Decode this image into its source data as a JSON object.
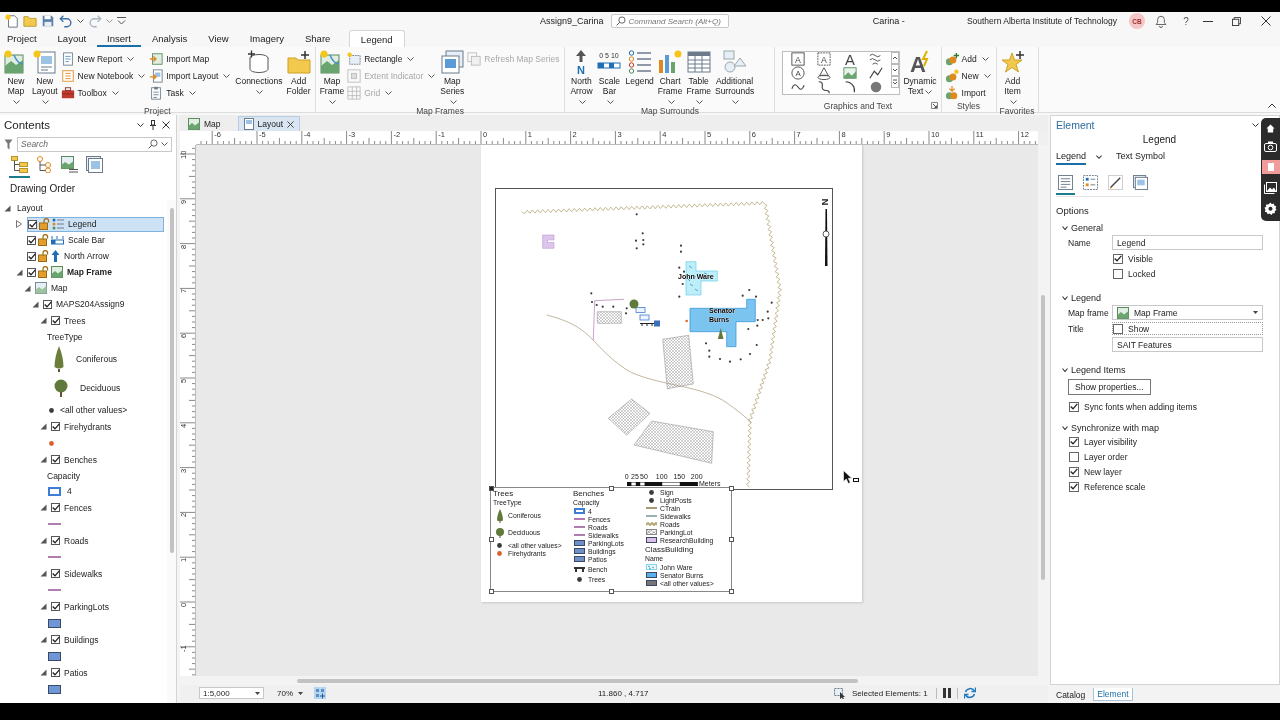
{
  "title_bar": {
    "project": "Assign9_Carina",
    "search": {
      "placeholder": "Command Search (Alt+Q)"
    },
    "user": "Carina -",
    "organization": "Southern Alberta Institute of Technology",
    "avatar": "CB",
    "help": "?"
  },
  "ribbon": {
    "tabs": [
      {
        "label": "Project",
        "selected": false,
        "contextual": false
      },
      {
        "label": "Layout",
        "selected": false,
        "contextual": false
      },
      {
        "label": "Insert",
        "selected": true,
        "contextual": false
      },
      {
        "label": "Analysis",
        "selected": false,
        "contextual": false
      },
      {
        "label": "View",
        "selected": false,
        "contextual": false
      },
      {
        "label": "Imagery",
        "selected": false,
        "contextual": false
      },
      {
        "label": "Share",
        "selected": false,
        "contextual": false
      },
      {
        "label": "Legend",
        "selected": false,
        "contextual": true
      }
    ],
    "groups": [
      {
        "label": "Project",
        "launcher": false,
        "items": [
          {
            "kind": "large",
            "label": "New Map",
            "dropdown": true,
            "disabled": false
          },
          {
            "kind": "large",
            "label": "New Layout",
            "dropdown": true,
            "disabled": false
          },
          {
            "kind": "stack",
            "items": [
              {
                "label": "New Report",
                "dropdown": true,
                "disabled": false
              },
              {
                "label": "New Notebook",
                "dropdown": true,
                "disabled": false
              },
              {
                "label": "Toolbox",
                "dropdown": true,
                "disabled": false
              }
            ]
          },
          {
            "kind": "stack",
            "items": [
              {
                "label": "Import Map",
                "dropdown": false,
                "disabled": false
              },
              {
                "label": "Import Layout",
                "dropdown": true,
                "disabled": false
              },
              {
                "label": "Task",
                "dropdown": true,
                "disabled": false
              }
            ]
          },
          {
            "kind": "large",
            "label": "Connections",
            "dropdown": true,
            "disabled": false
          },
          {
            "kind": "large",
            "label": "Add Folder",
            "dropdown": false,
            "disabled": false
          }
        ]
      },
      {
        "label": "Map Frames",
        "launcher": false,
        "items": [
          {
            "kind": "large",
            "label": "Map Frame",
            "dropdown": true,
            "disabled": false
          },
          {
            "kind": "stack",
            "items": [
              {
                "label": "Rectangle",
                "dropdown": true,
                "disabled": false
              },
              {
                "label": "Extent Indicator",
                "dropdown": true,
                "disabled": true
              },
              {
                "label": "Grid",
                "dropdown": true,
                "disabled": true
              }
            ]
          },
          {
            "kind": "large",
            "label": "Map Series",
            "dropdown": true,
            "disabled": false
          },
          {
            "kind": "stack",
            "items": [
              {
                "label": "Refresh Map Series",
                "dropdown": false,
                "disabled": true
              }
            ]
          }
        ]
      },
      {
        "label": "Map Surrounds",
        "launcher": false,
        "items": [
          {
            "kind": "large",
            "label": "North Arrow",
            "icon_text": "N",
            "dropdown": true,
            "disabled": false
          },
          {
            "kind": "large",
            "label": "Scale Bar",
            "icon_text": "0 5 10",
            "dropdown": true,
            "disabled": false
          },
          {
            "kind": "large",
            "label": "Legend",
            "dropdown": false,
            "disabled": false
          },
          {
            "kind": "large",
            "label": "Chart Frame",
            "dropdown": true,
            "disabled": false
          },
          {
            "kind": "large",
            "label": "Table Frame",
            "dropdown": true,
            "disabled": false
          },
          {
            "kind": "large",
            "label": "Additional Surrounds",
            "dropdown": true,
            "disabled": false
          }
        ]
      },
      {
        "label": "Graphics and Text",
        "launcher": true,
        "items": [
          {
            "kind": "gallery",
            "items": [
              {
                "kind": "text",
                "icon_text": "A"
              },
              {
                "kind": "text",
                "icon_text": "A"
              },
              {
                "kind": "text",
                "icon_text": "A"
              },
              {
                "kind": "graphic"
              },
              {
                "kind": "text",
                "icon_text": "A"
              },
              {
                "kind": "graphic"
              },
              {
                "kind": "graphic"
              },
              {
                "kind": "graphic"
              },
              {
                "kind": "graphic"
              },
              {
                "kind": "graphic"
              },
              {
                "kind": "graphic"
              },
              {
                "kind": "graphic"
              }
            ]
          },
          {
            "kind": "large",
            "label": "Dynamic Text",
            "icon_text": "A",
            "dropdown": true,
            "disabled": false
          }
        ]
      },
      {
        "label": "Styles",
        "launcher": false,
        "items": [
          {
            "kind": "stack",
            "items": [
              {
                "label": "Add",
                "dropdown": true,
                "disabled": false
              },
              {
                "label": "New",
                "dropdown": true,
                "disabled": false
              },
              {
                "label": "Import",
                "dropdown": false,
                "disabled": false
              }
            ]
          }
        ]
      },
      {
        "label": "Favorites",
        "launcher": false,
        "items": [
          {
            "kind": "large",
            "label": "Add Item",
            "dropdown": true,
            "disabled": false
          }
        ]
      }
    ]
  },
  "contents": {
    "title": "Contents",
    "search": {
      "placeholder": "Search"
    },
    "view_tabs": [
      {
        "selected": true
      },
      {
        "selected": false
      },
      {
        "selected": false
      },
      {
        "selected": false
      }
    ],
    "heading": "Drawing Order",
    "tree": [
      {
        "label": "Layout",
        "expanded": true,
        "selected": false,
        "children": [
          {
            "label": "Legend",
            "kind": "legend",
            "expanded": false,
            "checked": true,
            "selected": true
          },
          {
            "label": "Scale Bar",
            "kind": "scale_bar",
            "checked": true,
            "selected": false
          },
          {
            "label": "North Arrow",
            "kind": "north_arrow",
            "checked": true,
            "selected": false
          },
          {
            "label": "Map Frame",
            "kind": "map_frame",
            "expanded": true,
            "checked": true,
            "selected": false,
            "children": [
              {
                "label": "Map",
                "kind": "map",
                "expanded": true,
                "selected": false,
                "children": [
                  {
                    "label": "MAPS204Assign9",
                    "expanded": true,
                    "checked": true,
                    "selected": false,
                    "children": [
                      {
                        "label": "Trees",
                        "kind": "layer",
                        "expanded": true,
                        "checked": true,
                        "selected": false,
                        "field": "TreeType",
                        "symbols": [
                          {
                            "kind": "conifer",
                            "label": "Coniferous",
                            "color": "#6b7d3a"
                          },
                          {
                            "kind": "deciduous",
                            "label": "Deciduous",
                            "color": "#5f7a3a"
                          },
                          {
                            "kind": "point",
                            "label": "<all other values>",
                            "color": "#3c3c3c"
                          }
                        ]
                      },
                      {
                        "label": "Firehydrants",
                        "kind": "layer",
                        "expanded": true,
                        "checked": true,
                        "selected": false,
                        "symbols": [
                          {
                            "kind": "point",
                            "color": "#d9622b"
                          }
                        ]
                      },
                      {
                        "label": "Benches",
                        "kind": "layer",
                        "expanded": true,
                        "checked": true,
                        "selected": false,
                        "field": "Capacity",
                        "symbols": [
                          {
                            "kind": "outline",
                            "label": "4",
                            "color": "#3d7dd6"
                          }
                        ]
                      },
                      {
                        "label": "Fences",
                        "kind": "layer",
                        "expanded": true,
                        "checked": true,
                        "selected": false,
                        "symbols": [
                          {
                            "kind": "line",
                            "color": "#b07cb0"
                          }
                        ]
                      },
                      {
                        "label": "Roads",
                        "kind": "layer",
                        "expanded": true,
                        "checked": true,
                        "selected": false,
                        "symbols": [
                          {
                            "kind": "line",
                            "color": "#b07cb0"
                          }
                        ]
                      },
                      {
                        "label": "Sidewalks",
                        "kind": "layer",
                        "expanded": true,
                        "checked": true,
                        "selected": false,
                        "symbols": [
                          {
                            "kind": "line",
                            "color": "#b07cb0"
                          }
                        ]
                      },
                      {
                        "label": "ParkingLots",
                        "kind": "layer",
                        "expanded": true,
                        "checked": true,
                        "selected": false,
                        "symbols": [
                          {
                            "kind": "fill",
                            "color": "#6f97d6"
                          }
                        ]
                      },
                      {
                        "label": "Buildings",
                        "kind": "layer",
                        "expanded": true,
                        "checked": true,
                        "selected": false,
                        "symbols": [
                          {
                            "kind": "fill",
                            "color": "#6f97d6"
                          }
                        ]
                      },
                      {
                        "label": "Patios",
                        "kind": "layer",
                        "expanded": true,
                        "checked": true,
                        "selected": false,
                        "symbols": [
                          {
                            "kind": "fill",
                            "color": "#6f97d6"
                          }
                        ]
                      }
                    ]
                  }
                ]
              }
            ]
          }
        ]
      }
    ]
  },
  "document_tabs": [
    {
      "label": "Map",
      "selected": false
    },
    {
      "label": "Layout",
      "selected": true
    }
  ],
  "rulers": {
    "horizontal": [
      "-6",
      "-5",
      "-4",
      "-3",
      "-2",
      "-1",
      "0",
      "1",
      "2",
      "3",
      "4",
      "5",
      "6",
      "7",
      "8",
      "9",
      "10",
      "11",
      "12"
    ],
    "vertical": [
      "10",
      "9",
      "8",
      "7",
      "6",
      "5",
      "4",
      "3",
      "2",
      "1",
      "0",
      "-1"
    ]
  },
  "layout_view": {
    "map_frame": {
      "labels": [
        "John Ware",
        "Senator Burns"
      ],
      "north_arrow": {
        "label": "N"
      },
      "scale_bar": {
        "ticks": [
          "0",
          "25",
          "50",
          "100",
          "150",
          "200"
        ],
        "unit": "Meters"
      }
    },
    "legend": {
      "selected": true,
      "columns": [
        [
          {
            "kind": "heading",
            "label": "Trees"
          },
          {
            "kind": "field",
            "label": "TreeType"
          },
          {
            "kind": "conifer",
            "label": "Coniferous",
            "color": "#5f7a3a"
          },
          {
            "kind": "deciduous",
            "label": "Deciduous",
            "color": "#5f7a3a"
          },
          {
            "kind": "point",
            "label": "<all other values>",
            "color": "#3c3c3c"
          },
          {
            "kind": "point",
            "label": "Firehydrants",
            "color": "#d9622b"
          }
        ],
        [
          {
            "kind": "heading",
            "label": "Benches"
          },
          {
            "kind": "field",
            "label": "Capacity"
          },
          {
            "kind": "outline",
            "label": "4",
            "color": "#3d7dd6"
          },
          {
            "kind": "line",
            "label": "Fences",
            "color": "#b07cb0"
          },
          {
            "kind": "line",
            "label": "Roads",
            "color": "#b07cb0"
          },
          {
            "kind": "line",
            "label": "Sidewalks",
            "color": "#b07cb0"
          },
          {
            "kind": "fill",
            "label": "ParkingLots",
            "color": "#6f8fc8"
          },
          {
            "kind": "fill",
            "label": "Buildings",
            "color": "#6f8fc8"
          },
          {
            "kind": "fill",
            "label": "Patios",
            "color": "#6f8fc8"
          },
          {
            "kind": "bench",
            "label": "Bench",
            "color": "#333333"
          },
          {
            "kind": "point",
            "label": "Trees",
            "color": "#3c3c3c"
          }
        ],
        [
          {
            "kind": "point",
            "label": "Sign",
            "color": "#3c3c3c"
          },
          {
            "kind": "point",
            "label": "LightPosts",
            "color": "#3c3c3c"
          },
          {
            "kind": "line",
            "label": "CTrain",
            "color": "#a89a78"
          },
          {
            "kind": "line",
            "label": "Sidewalks",
            "color": "#9ab0b0"
          },
          {
            "kind": "zigzag",
            "label": "Roads",
            "color": "#b5a878"
          },
          {
            "kind": "hatch",
            "label": "ParkingLot",
            "color": "#888888"
          },
          {
            "kind": "fill",
            "label": "ResearchBuilding",
            "color": "#d8c0e8"
          },
          {
            "kind": "heading",
            "label": "ClassBuilding"
          },
          {
            "kind": "field",
            "label": "Name"
          },
          {
            "kind": "pattern",
            "label": "John Ware",
            "color": "#7fd8f0"
          },
          {
            "kind": "fill",
            "label": "Senator Burns",
            "color": "#5ab0e8"
          },
          {
            "kind": "fill",
            "label": "<all other values>",
            "color": "#777777"
          }
        ]
      ]
    }
  },
  "status_bar": {
    "scale": "1:5,000",
    "zoom": "70%",
    "coordinates": "11.860 , 4.717",
    "selection": "Selected Elements: 1"
  },
  "element_pane": {
    "title": "Element",
    "element": "Legend",
    "tabs": [
      {
        "label": "Legend",
        "selected": true,
        "dropdown": true
      },
      {
        "label": "Text Symbol",
        "selected": false,
        "dropdown": false
      }
    ],
    "view_tabs": [
      {
        "selected": true
      },
      {
        "selected": false
      },
      {
        "selected": false
      },
      {
        "selected": false
      }
    ],
    "section": "Options",
    "groups": [
      {
        "label": "General",
        "kind": "form",
        "expanded": true,
        "rows": [
          {
            "kind": "text",
            "label": "Name",
            "value": "Legend"
          },
          {
            "kind": "checkbox",
            "label": "Visible",
            "checked": true,
            "focused": false
          },
          {
            "kind": "checkbox",
            "label": "Locked",
            "checked": false,
            "focused": false
          }
        ]
      },
      {
        "label": "Legend",
        "kind": "form",
        "expanded": true,
        "rows": [
          {
            "kind": "dropdown",
            "label": "Map frame",
            "value": "Map Frame"
          },
          {
            "kind": "checkbox",
            "caption": "Title",
            "label": "Show",
            "checked": false,
            "focused": true
          },
          {
            "kind": "text",
            "value": "SAIT Features"
          }
        ]
      },
      {
        "label": "Legend Items",
        "kind": "list",
        "expanded": true,
        "rows": [
          {
            "kind": "button",
            "label": "Show properties..."
          },
          {
            "kind": "checkbox",
            "label": "Sync fonts when adding items",
            "checked": true,
            "focused": false
          }
        ]
      },
      {
        "label": "Synchronize with map",
        "kind": "list",
        "expanded": true,
        "rows": [
          {
            "kind": "checkbox",
            "label": "Layer visibility",
            "checked": true,
            "focused": false
          },
          {
            "kind": "checkbox",
            "label": "Layer order",
            "checked": false,
            "focused": false
          },
          {
            "kind": "checkbox",
            "label": "New layer",
            "checked": true,
            "focused": false
          },
          {
            "kind": "checkbox",
            "label": "Reference scale",
            "checked": true,
            "focused": false
          }
        ]
      }
    ]
  },
  "bottom_tabs": [
    {
      "label": "Catalog",
      "selected": false
    },
    {
      "label": "Element",
      "selected": true
    }
  ]
}
